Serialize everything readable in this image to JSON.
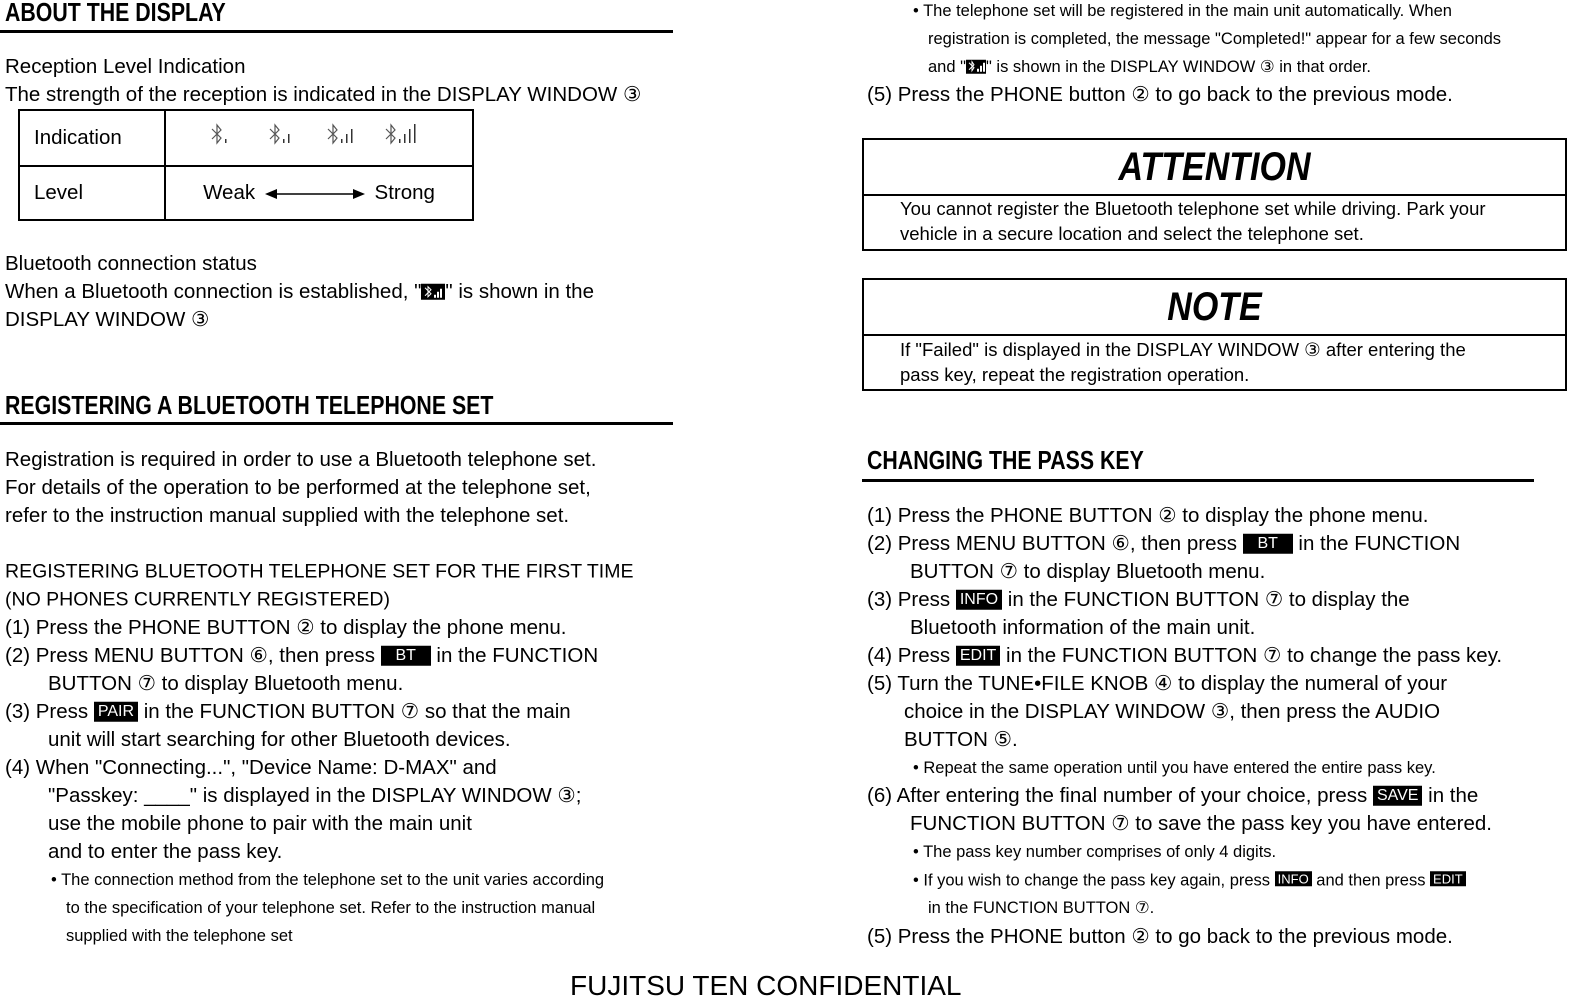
{
  "left": {
    "about_heading": "ABOUT THE DISPLAY",
    "reception_title": "Reception Level Indication",
    "reception_text": "The strength of the reception is indicated in the DISPLAY WINDOW ③",
    "table": {
      "row1_label": "Indication",
      "row2_label": "Level",
      "weak": "Weak",
      "strong": "Strong",
      "signal_levels": [
        1,
        2,
        3,
        4
      ]
    },
    "bt_status_title": "Bluetooth connection status",
    "bt_status_a": "When a Bluetooth connection is established, \"",
    "bt_status_b": "\" is shown in the",
    "bt_status_c": "DISPLAY WINDOW ③",
    "reg_heading": "REGISTERING A BLUETOOTH TELEPHONE SET",
    "reg_p1": "Registration is required in order to use a Bluetooth telephone set.",
    "reg_p2": "For details of the operation to be performed at the telephone set,",
    "reg_p3": "refer to the instruction manual supplied with the telephone set.",
    "first_time_1": "REGISTERING BLUETOOTH TELEPHONE SET FOR THE FIRST TIME",
    "first_time_2": "(NO PHONES CURRENTLY REGISTERED)",
    "s1": "(1)  Press the PHONE BUTTON ② to display the phone menu.",
    "s2a": "(2)  Press MENU BUTTON ⑥, then press ",
    "s2_badge": "BT",
    "s2b": " in the FUNCTION",
    "s2c": "BUTTON ⑦ to display Bluetooth menu.",
    "s3a": "(3)  Press ",
    "s3_badge": "PAIR",
    "s3b": " in the FUNCTION BUTTON ⑦ so that the main",
    "s3c": "unit will start searching for other Bluetooth devices.",
    "s4a": "(4)  When \"Connecting...\", \"Device Name: D-MAX\" and",
    "s4b": "\"Passkey: ____\" is displayed in the DISPLAY WINDOW ③;",
    "s4c": "use the mobile phone to pair with the main unit",
    "s4d": "and to enter the pass key.",
    "n1": "• The connection method from the telephone set to the unit varies according",
    "n2": "to the specification of your telephone set. Refer to the instruction manual",
    "n3": "supplied with the telephone set"
  },
  "right": {
    "t1": "• The telephone set will be registered in the main unit automatically. When",
    "t2": "registration is completed, the message \"Completed!\" appear for a few seconds",
    "t3a": "and \"",
    "t3b": "\" is shown in the DISPLAY WINDOW ③ in that order.",
    "s5": "(5)  Press the PHONE button ② to go back to the previous mode.",
    "attention_title": "ATTENTION",
    "attention_1": "You cannot register the Bluetooth telephone set while driving. Park your",
    "attention_2": "vehicle  in a secure location and select the telephone set.",
    "note_title": "NOTE",
    "note_1": "If \"Failed\" is displayed in the DISPLAY WINDOW  ③ after entering the",
    "note_2": "pass key, repeat the registration operation.",
    "pk_heading": "CHANGING THE PASS KEY",
    "p1": "(1)  Press the PHONE BUTTON ② to display the phone menu.",
    "p2a": "(2)  Press MENU BUTTON ⑥, then press ",
    "p2_badge": "BT",
    "p2b": " in the FUNCTION",
    "p2c": "BUTTON ⑦ to display Bluetooth menu.",
    "p3a": "(3)  Press ",
    "p3_badge": "INFO",
    "p3b": " in the FUNCTION BUTTON ⑦ to display the",
    "p3c": "Bluetooth information of the main unit.",
    "p4a": "(4)  Press ",
    "p4_badge": "EDIT",
    "p4b": " in the FUNCTION BUTTON ⑦ to change the pass key.",
    "p5a": "(5)  Turn the TUNE•FILE KNOB ④ to display the numeral of your",
    "p5b": "choice in the DISPLAY WINDOW ③, then press the AUDIO",
    "p5c": "BUTTON ⑤.",
    "p5n": "• Repeat the same operation until you have entered the entire pass key.",
    "p6a": "(6)  After entering the final number of your choice, press ",
    "p6_badge": "SAVE",
    "p6b": " in the",
    "p6c": "FUNCTION BUTTON ⑦ to save the pass key you have entered.",
    "p6n1": "• The pass key number comprises of only 4 digits.",
    "p6n2a": "• If you wish to change the pass key again, press ",
    "p6n2_badge1": "INFO",
    "p6n2b": "  and then press ",
    "p6n2_badge2": "EDIT",
    "p6n3": "in the FUNCTION BUTTON ⑦.",
    "p7": "(5)  Press the PHONE button ② to go back to the previous mode."
  },
  "footer": "FUJITSU TEN CONFIDENTIAL"
}
